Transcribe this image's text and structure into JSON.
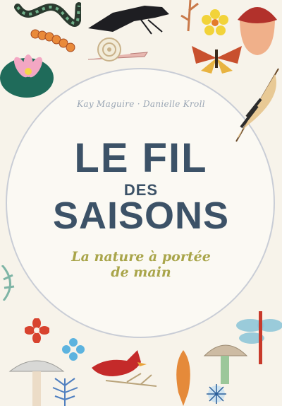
{
  "book": {
    "authors": "Kay Maguire · Danielle Kroll",
    "title_line1": "LE FIL",
    "title_line2": "DES",
    "title_line3": "SAISONS",
    "subtitle_line1": "La nature à portée",
    "subtitle_line2": "de main"
  },
  "colors": {
    "background": "#f7f3ea",
    "title": "#3c5267",
    "subtitle": "#a9a54a",
    "ring": "#c9cdd6"
  },
  "illustrations": [
    "snake-icon",
    "raven-icon",
    "twig-icon",
    "yellow-flower-icon",
    "acorn-icon",
    "caterpillar-icon",
    "snail-icon",
    "moth-icon",
    "water-lily-icon",
    "feather-icon",
    "red-flower-icon",
    "blue-flower-icon",
    "mushroom-icon",
    "cardinal-icon",
    "dragonfly-icon",
    "sea-urchin-icon",
    "seed-pod-icon",
    "leaf-icon"
  ]
}
